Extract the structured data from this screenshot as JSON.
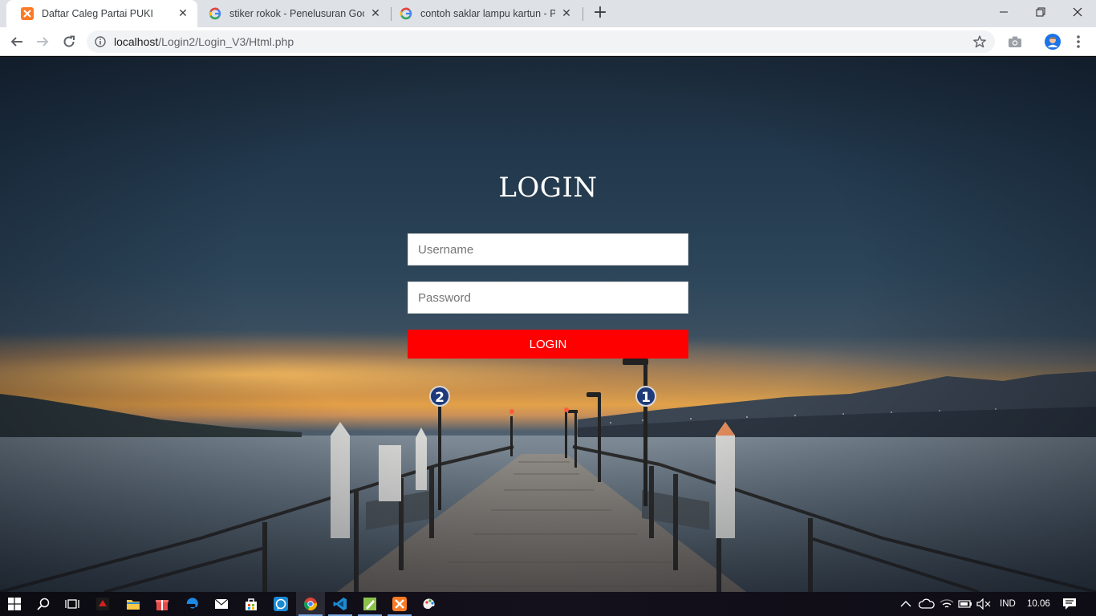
{
  "browser": {
    "tabs": [
      {
        "title": "Daftar Caleg Partai PUKI",
        "favicon": "xampp-icon",
        "active": true
      },
      {
        "title": "stiker rokok - Penelusuran Googl",
        "favicon": "google-icon",
        "active": false
      },
      {
        "title": "contoh saklar lampu kartun - Pen",
        "favicon": "google-icon",
        "active": false
      }
    ],
    "close_glyph": "✕",
    "new_tab_glyph": "+",
    "url_host": "localhost",
    "url_path": "/Login2/Login_V3/Html.php"
  },
  "login": {
    "heading": "LOGIN",
    "username_placeholder": "Username",
    "password_placeholder": "Password",
    "button_label": "LOGIN"
  },
  "scene": {
    "pier_sign_left": "2",
    "pier_sign_right": "1"
  },
  "taskbar": {
    "language": "IND",
    "time": "10.06"
  },
  "colors": {
    "login_button": "#ff0000",
    "tab_strip": "#dee1e6",
    "omnibox": "#f1f3f4"
  }
}
